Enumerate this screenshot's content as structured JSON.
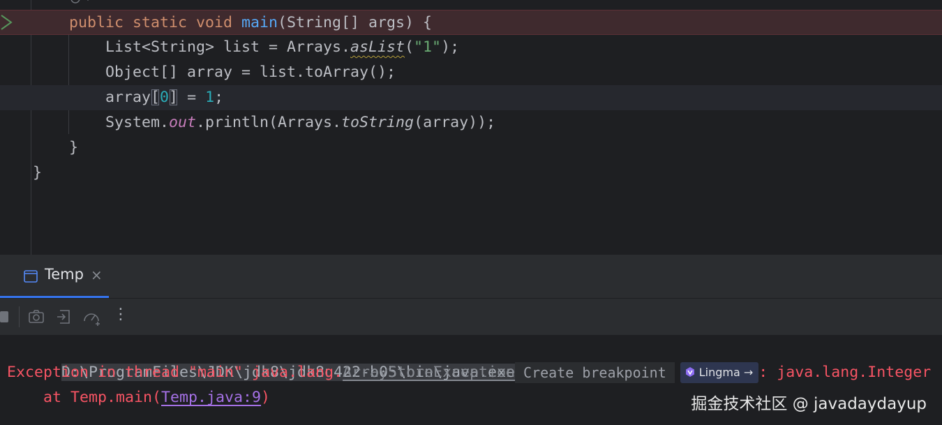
{
  "editor": {
    "lines": [
      {
        "kw1": "public static void ",
        "fn": "main",
        "rest": "(String[] args) {"
      },
      {
        "pre": "List<String> list = Arrays.",
        "method": "asList",
        "mid": "(",
        "str": "\"1\"",
        "post": ");"
      },
      {
        "text": "Object[] array = list.toArray();"
      },
      {
        "pre": "array",
        "bopen": "[",
        "num0": "0",
        "bclose": "]",
        "mid": " = ",
        "num1": "1",
        "post": ";"
      },
      {
        "pre": "System.",
        "field": "out",
        "mid": ".println(Arrays.",
        "method": "toString",
        "post": "(array));"
      },
      {
        "text": "}"
      },
      {
        "text": "}"
      }
    ]
  },
  "run_panel": {
    "tab_label": "Temp",
    "tab_close": "×",
    "more_icon": "⋮",
    "console": {
      "command": "D:\\ProgramFiles\\JDK\\jdk8\\jdk8u422-b05\\bin\\java.exe ...",
      "exception_prefix": "Exception in thread \"main\" java.lang.",
      "exception_class": "ArrayStoreException",
      "create_breakpoint": "Create breakpoint",
      "lingma_label": "Lingma",
      "lingma_arrow": "→",
      "exception_suffix": ": java.lang.Integer",
      "stack_prefix": "    at Temp.main(",
      "stack_link": "Temp.java:9",
      "stack_suffix": ")"
    }
  },
  "watermark": "掘金技术社区 @ javadaydayup",
  "colors": {
    "keyword": "#cf8e6d",
    "function": "#56a8f5",
    "string": "#6aab73",
    "number": "#2aacb8",
    "error": "#f75464",
    "accent": "#3574f0"
  }
}
